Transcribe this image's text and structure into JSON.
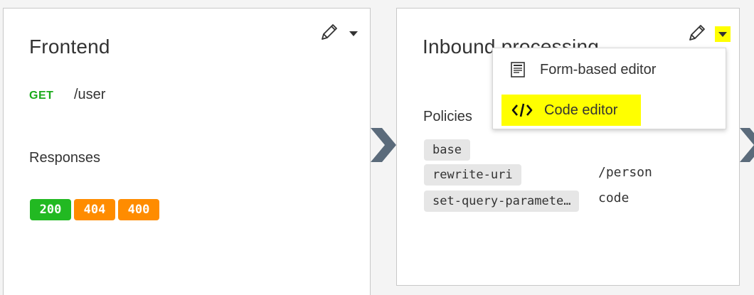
{
  "frontend": {
    "title": "Frontend",
    "method": "GET",
    "path": "/user",
    "responses_label": "Responses",
    "responses": [
      {
        "code": "200",
        "status": "success"
      },
      {
        "code": "404",
        "status": "warning"
      },
      {
        "code": "400",
        "status": "warning"
      }
    ]
  },
  "inbound": {
    "title": "Inbound processing",
    "policies_label": "Policies",
    "policies": [
      {
        "name": "base",
        "value": ""
      },
      {
        "name": "rewrite-uri",
        "value": "/person"
      },
      {
        "name": "set-query-paramete…",
        "value": "code"
      }
    ]
  },
  "dropdown_menu": {
    "items": [
      {
        "label": "Form-based editor",
        "icon": "form-icon"
      },
      {
        "label": "Code editor",
        "icon": "code-icon",
        "highlighted": true
      }
    ]
  },
  "colors": {
    "success": "#22b922",
    "warning": "#ff8c00",
    "method_get": "#1aaa1a",
    "highlight": "#ffff00",
    "connector": "#5b6b7b"
  }
}
